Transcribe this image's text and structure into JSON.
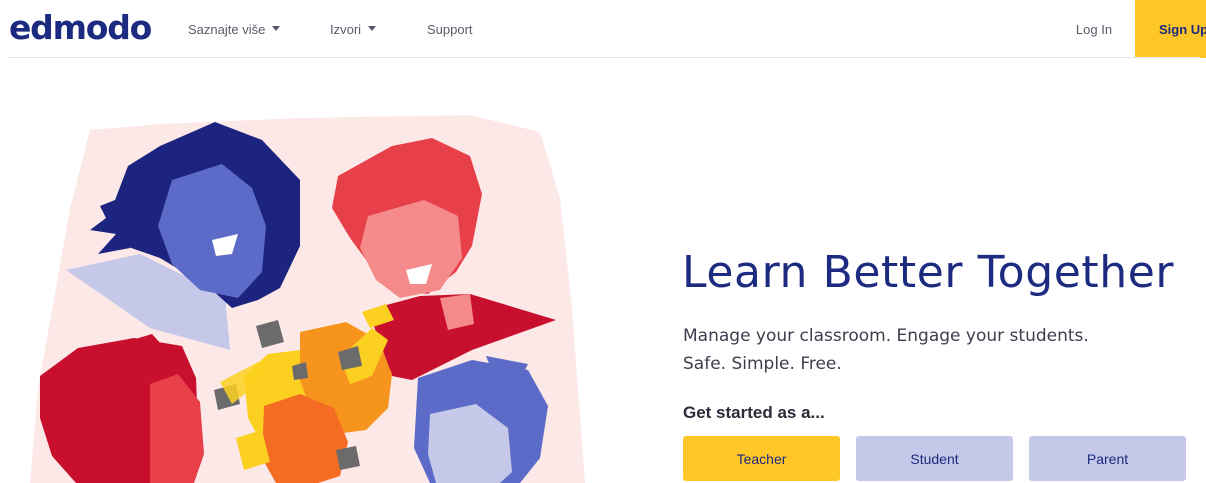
{
  "header": {
    "logo": "edmodo",
    "nav": [
      {
        "label": "Saznajte više",
        "has_dropdown": true
      },
      {
        "label": "Izvori",
        "has_dropdown": true
      },
      {
        "label": "Support",
        "has_dropdown": false
      }
    ],
    "login_label": "Log In",
    "signup_label": "Sign Up"
  },
  "hero": {
    "title": "Learn Better Together",
    "subtitle_lines": [
      "Manage your classroom. Engage your students.",
      "Safe. Simple. Free."
    ],
    "get_started": "Get started as a...",
    "roles": [
      "Teacher",
      "Student",
      "Parent"
    ]
  },
  "colors": {
    "brand_navy": "#1c2a80",
    "accent_yellow": "#ffc627",
    "role_lavender": "#c5c8e8",
    "art_blush": "#fde8e8",
    "art_red": "#e8404a",
    "art_blue": "#5b6bc7",
    "art_orange": "#f7941d"
  }
}
